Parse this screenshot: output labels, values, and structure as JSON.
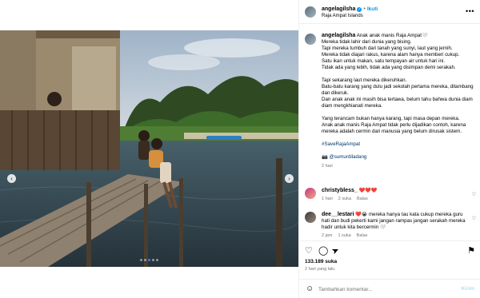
{
  "post": {
    "username": "angelagilsha",
    "follow_label": "Ikuti",
    "location": "Raja Ampat Islands",
    "more_label": "•••",
    "verified_mark": "✓"
  },
  "media": {
    "prev_glyph": "‹",
    "next_glyph": "›",
    "carousel": {
      "count": 5,
      "active_index": 2
    }
  },
  "caption": {
    "username": "angelagilsha",
    "p1": "Anak anak manis Raja Ampat🤍",
    "p2": "Mereka tidak lahir dari dunia yang bising.\nTapi mereka tumbuh dari tanah yang sunyi, laut yang jernih.\nMereka tidak diajari rakus, karena alam hanya memberi cukup.\nSatu ikan untuk makan, satu tempayan air untuk hari ini.\nTidak ada yang lebih, tidak ada yang disimpan demi serakah.",
    "p3": "Tapi sekarang laut mereka dikeruhkan.\nBatu-batu karang yang dulu jadi sekolah pertama mereka, ditambang dan dikeruk.\nDan anak anak ini masih bisa tertawa, belum tahu bahwa dunia diam diam mengkhianati mereka.",
    "p4": "Yang terancam bukan hanya karang, tapi masa depan mereka.\nAnak anak manis Raja Ampat tidak perlu dijadikan contoh, karena mereka adalah cermin dari manusia yang belum dirusak sistem.",
    "hashtag": "#SaveRajaAmpat",
    "credit_icon": "📷",
    "credit": "@sumurdiladang",
    "time": "2 hari"
  },
  "comments": [
    {
      "username": "christybless_",
      "text": "❤️❤️❤️",
      "time": "1 hari",
      "likes": "2 suka",
      "reply": "Balas"
    },
    {
      "username": "dee__lestari",
      "text": "❤️😭 mereka hanya tau kata cukup mereka guru hati dan budi pekerti kami jangan rampas jangan serakah mereka hadir untuk kita bercermin 🤍",
      "time": "2 jam",
      "likes": "1 suka",
      "reply": "Balas"
    }
  ],
  "actions": {
    "like_icon": "♡",
    "comment_icon": "◯",
    "share_icon": "➤",
    "save_icon": "⚑",
    "comment_heart_icon": "♡"
  },
  "stats": {
    "likes": "133.189 suka",
    "date": "2 hari yang lalu"
  },
  "composer": {
    "emoji_icon": "☺",
    "placeholder": "Tambahkan komentar...",
    "post_label": "Kirim"
  }
}
